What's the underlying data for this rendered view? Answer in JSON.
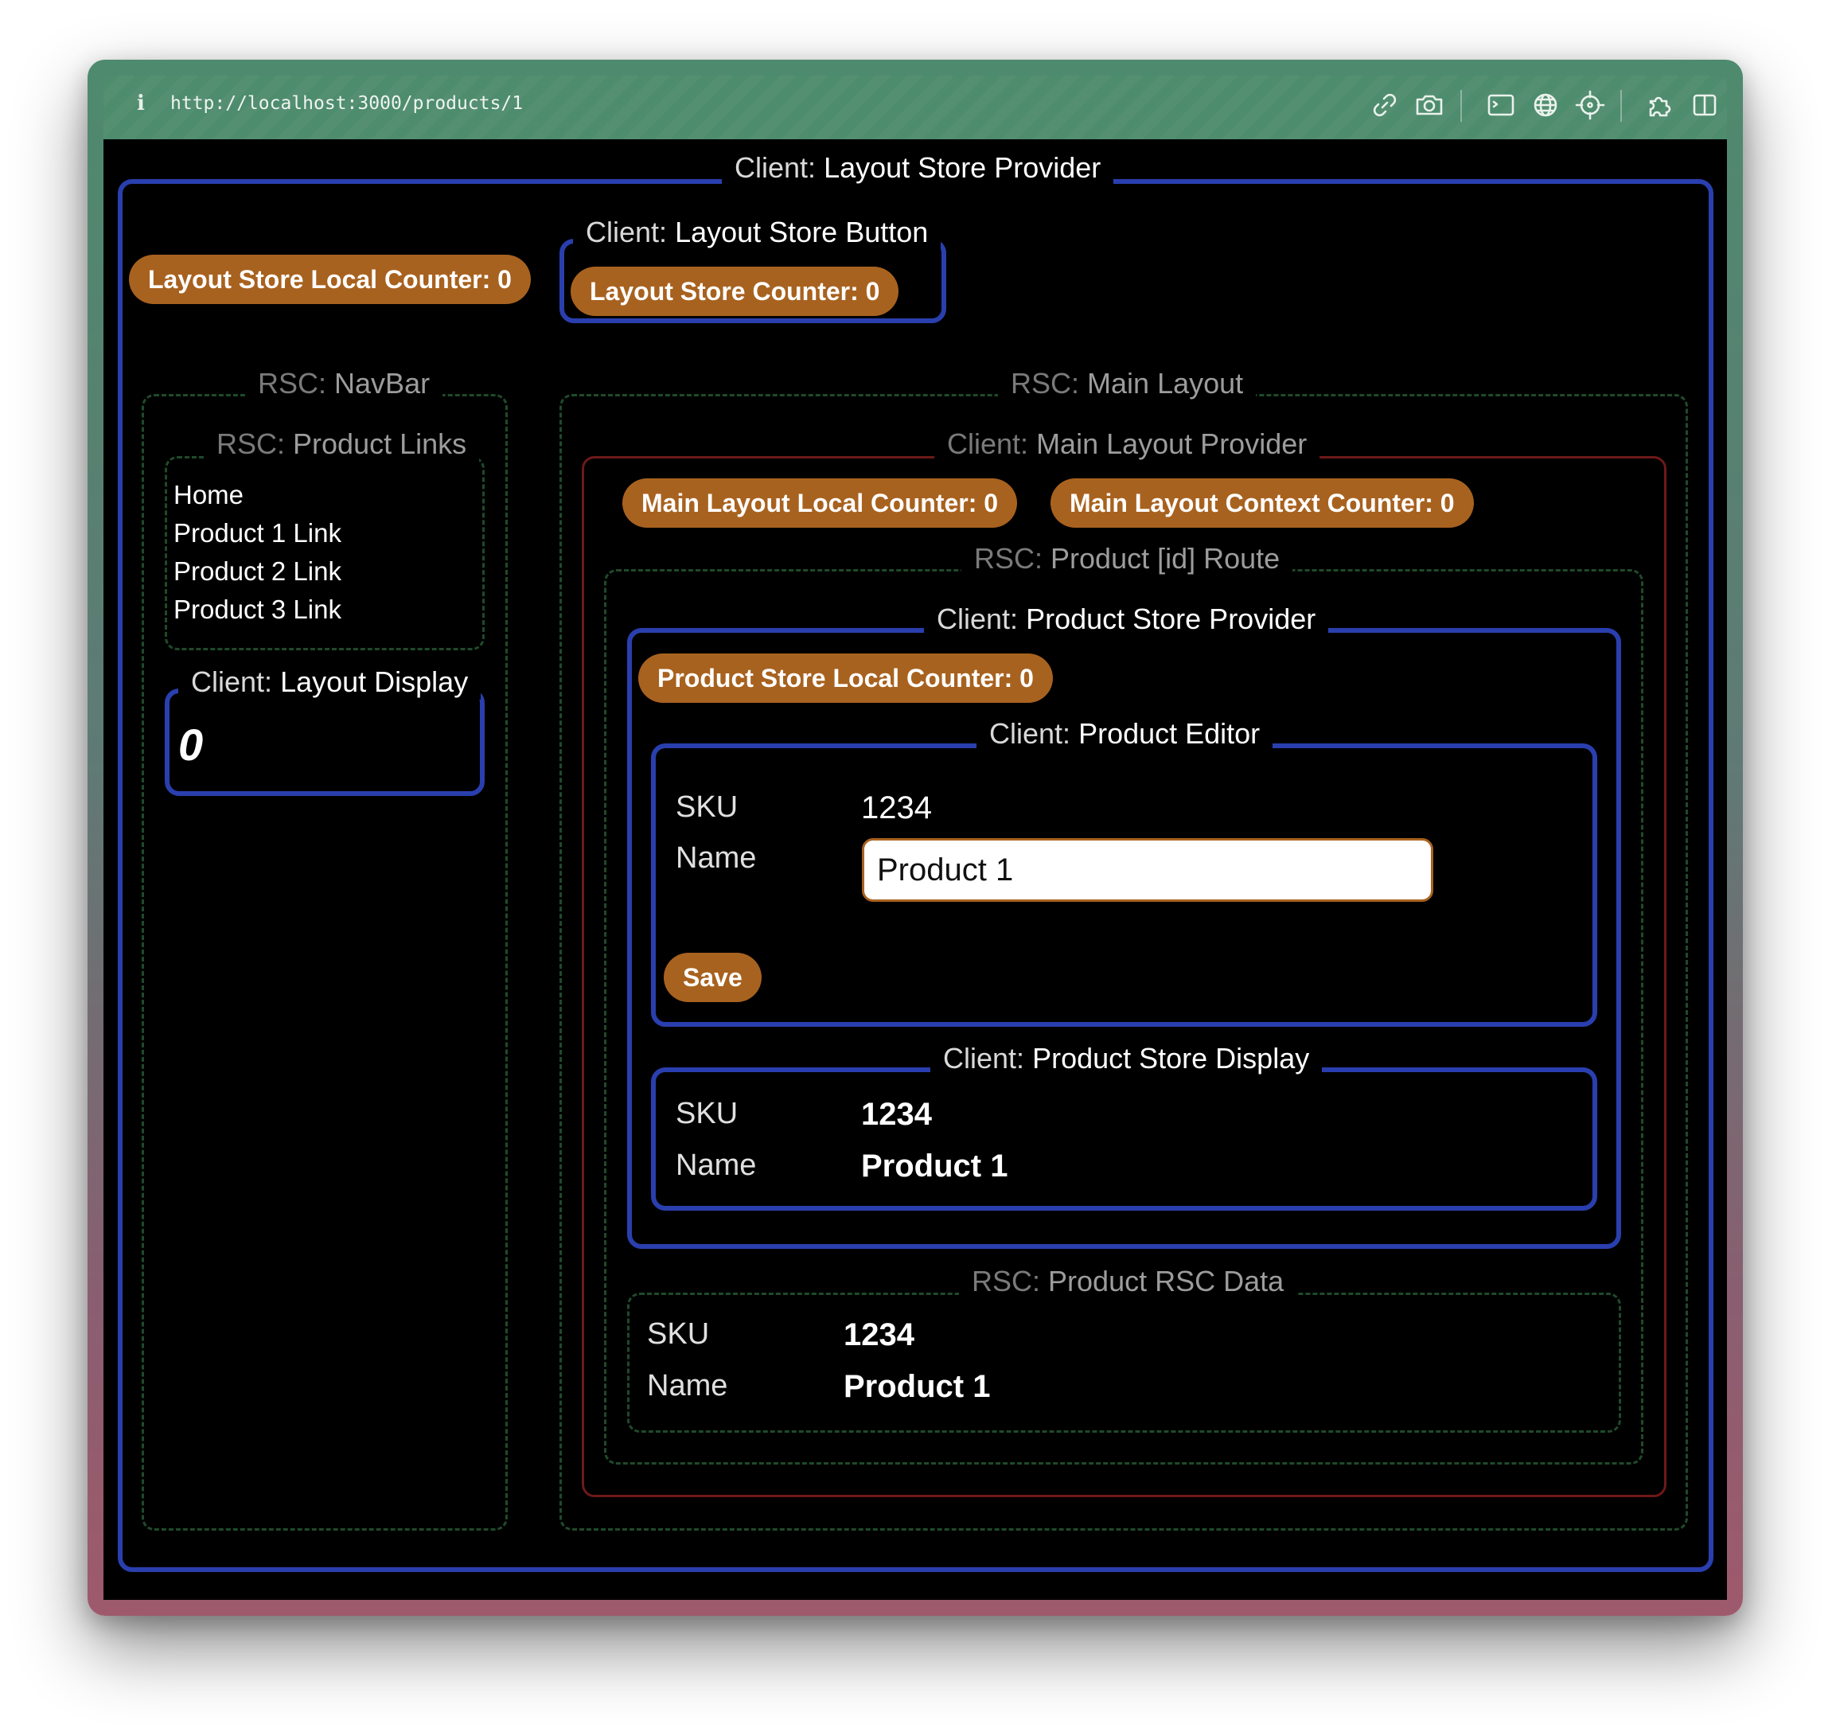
{
  "browser": {
    "info_icon": "i",
    "url": "http://localhost:3000/products/1",
    "toolbar_icons": [
      "link-icon",
      "camera-icon",
      "terminal-icon",
      "globe-icon",
      "crosshair-icon",
      "puzzle-icon",
      "sidebar-icon"
    ]
  },
  "labels": {
    "client_prefix": "Client:",
    "rsc_prefix": "RSC:"
  },
  "layout_store_provider": {
    "title": "Layout Store Provider",
    "local_counter": "Layout Store Local Counter: 0"
  },
  "layout_store_button": {
    "title": "Layout Store Button",
    "counter": "Layout Store Counter: 0"
  },
  "navbar": {
    "title": "NavBar",
    "product_links": {
      "title": "Product Links",
      "items": [
        "Home",
        "Product 1 Link",
        "Product 2 Link",
        "Product 3 Link"
      ]
    },
    "layout_display": {
      "title": "Layout Display",
      "value": "0"
    }
  },
  "main_layout": {
    "title": "Main Layout",
    "provider": {
      "title": "Main Layout Provider",
      "local_counter": "Main Layout Local Counter: 0",
      "context_counter": "Main Layout Context Counter: 0"
    }
  },
  "product_route": {
    "title": "Product [id] Route",
    "store_provider": {
      "title": "Product Store Provider",
      "local_counter": "Product Store Local Counter: 0"
    },
    "editor": {
      "title": "Product Editor",
      "sku_label": "SKU",
      "sku_value": "1234",
      "name_label": "Name",
      "name_value": "Product 1",
      "save_label": "Save"
    },
    "store_display": {
      "title": "Product Store Display",
      "sku_label": "SKU",
      "sku_value": "1234",
      "name_label": "Name",
      "name_value": "Product 1"
    },
    "rsc_data": {
      "title": "Product RSC Data",
      "sku_label": "SKU",
      "sku_value": "1234",
      "name_label": "Name",
      "name_value": "Product 1"
    }
  },
  "colors": {
    "client_border": "#2a3fae",
    "rsc_border": "#1f4a2a",
    "provider_border": "#6e1919",
    "accent": "#a8621f"
  }
}
